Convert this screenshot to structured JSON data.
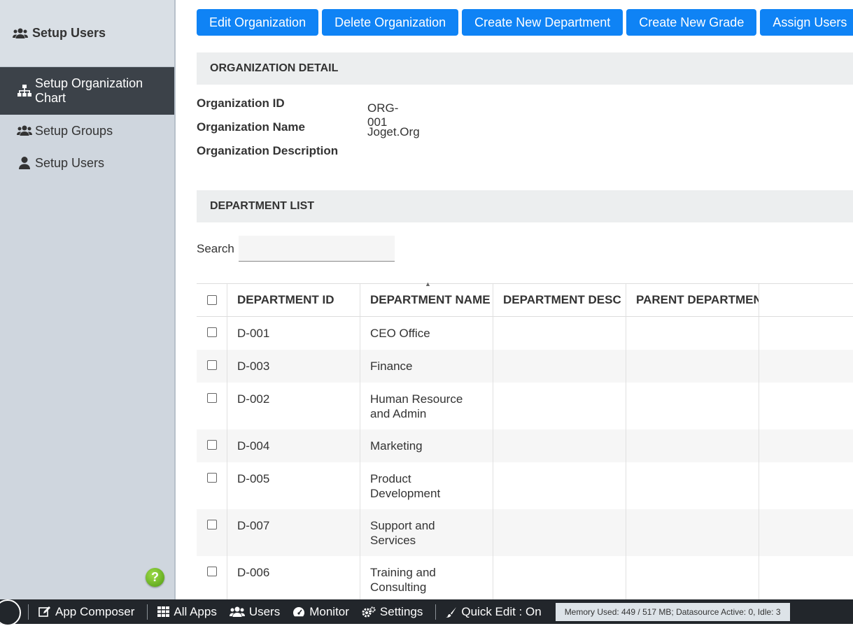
{
  "sidebar": {
    "header": "Setup Users",
    "items": [
      {
        "label": "Setup Organization Chart",
        "icon": "sitemap-icon",
        "active": true
      },
      {
        "label": "Setup Groups",
        "icon": "users-icon",
        "active": false
      },
      {
        "label": "Setup Users",
        "icon": "user-icon",
        "active": false
      }
    ],
    "help_label": "?"
  },
  "toolbar": {
    "buttons": [
      "Edit Organization",
      "Delete Organization",
      "Create New Department",
      "Create New Grade",
      "Assign Users"
    ]
  },
  "organization_detail": {
    "title": "ORGANIZATION DETAIL",
    "fields": [
      {
        "label": "Organization ID",
        "value": "ORG-001"
      },
      {
        "label": "Organization Name",
        "value": "Joget.Org"
      },
      {
        "label": "Organization Description",
        "value": ""
      }
    ]
  },
  "department_list": {
    "title": "DEPARTMENT LIST",
    "search_label": "Search",
    "search_value": "",
    "columns": [
      "DEPARTMENT ID",
      "DEPARTMENT NAME",
      "DEPARTMENT DESC",
      "PARENT DEPARTMENT"
    ],
    "rows": [
      {
        "id": "D-001",
        "name": "CEO Office",
        "desc": "",
        "parent": ""
      },
      {
        "id": "D-003",
        "name": "Finance",
        "desc": "",
        "parent": ""
      },
      {
        "id": "D-002",
        "name": "Human Resource and Admin",
        "desc": "",
        "parent": ""
      },
      {
        "id": "D-004",
        "name": "Marketing",
        "desc": "",
        "parent": ""
      },
      {
        "id": "D-005",
        "name": "Product Development",
        "desc": "",
        "parent": ""
      },
      {
        "id": "D-007",
        "name": "Support and Services",
        "desc": "",
        "parent": ""
      },
      {
        "id": "D-006",
        "name": "Training and Consulting",
        "desc": "",
        "parent": ""
      }
    ]
  },
  "bottombar": {
    "app_composer": "App Composer",
    "all_apps": "All Apps",
    "users": "Users",
    "monitor": "Monitor",
    "settings": "Settings",
    "quick_edit": "Quick Edit : On",
    "memory": "Memory Used: 449 / 517 MB; Datasource Active: 0, Idle: 3"
  },
  "colors": {
    "primary_button": "#0f83f5",
    "sidebar_bg": "#cfd6de",
    "sidebar_active": "#3c4249",
    "bottombar_bg": "#22262b"
  }
}
